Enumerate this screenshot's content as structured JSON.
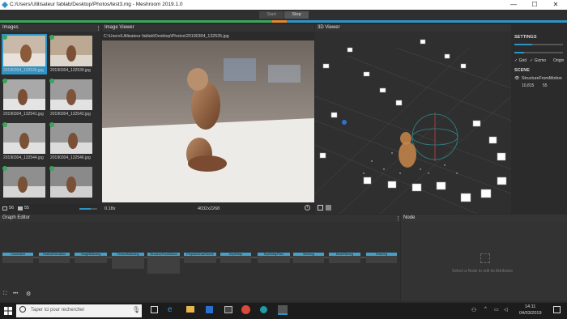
{
  "window": {
    "title": "C:/Users/Utilisateur fablab/Desktop/Photos/test3.mg - Meshroom 2019.1.0",
    "minimize": "—",
    "maximize": "☐",
    "close": "✕"
  },
  "toolbar": {
    "start_label": "Start",
    "stop_label": "Stop"
  },
  "images_panel": {
    "title": "Images",
    "menu_icon": "kebab-icon",
    "items": [
      {
        "label": "20190304_132535.jpg",
        "selected": true
      },
      {
        "label": "20190304_132539.jpg",
        "selected": false
      },
      {
        "label": "20190304_132541.jpg",
        "selected": false
      },
      {
        "label": "20190304_132542.jpg",
        "selected": false
      },
      {
        "label": "20190304_132544.jpg",
        "selected": false
      },
      {
        "label": "20190304_132546.jpg",
        "selected": false
      },
      {
        "label": "",
        "selected": false
      },
      {
        "label": "",
        "selected": false
      }
    ],
    "image_count": "56",
    "camera_count": "55"
  },
  "image_viewer": {
    "title": "Image Viewer",
    "path": "C:\\Users\\Utilisateur fablab\\Desktop\\Photos\\20190304_132535.jpg",
    "zoom": "0.18x",
    "resolution": "4032x2268"
  },
  "viewer_3d": {
    "title": "3D Viewer"
  },
  "settings": {
    "title": "SETTINGS",
    "grid_label": "Grid",
    "gizmo_label": "Gizmo",
    "origin_label": "Origin",
    "scene_title": "SCENE",
    "scene_item": "StructureFromMotion",
    "points": "10,815",
    "cameras": "55"
  },
  "graph_editor": {
    "title": "Graph Editor",
    "nodes": [
      "CameraInit",
      "FeatureExtraction",
      "ImageMatching",
      "FeatureMatching",
      "StructureFromMotion",
      "PrepareDenseScene",
      "DepthMap",
      "DepthMapFilter",
      "Meshing",
      "MeshFiltering",
      "Texturing"
    ]
  },
  "node_panel": {
    "title": "Node",
    "hint": "Select a Node to edit its Attributes"
  },
  "taskbar": {
    "search_placeholder": "Taper ici pour rechercher",
    "time": "14:11",
    "date": "04/03/2019"
  },
  "colors": {
    "accent": "#2f93c6",
    "progress_green": "#3aa55c",
    "progress_orange": "#e4882a",
    "node_header": "#45a0c8"
  }
}
